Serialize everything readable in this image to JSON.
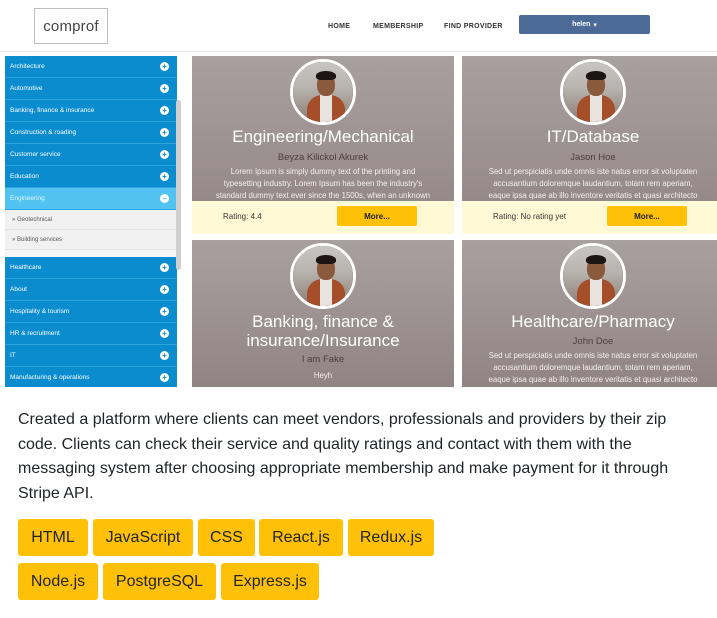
{
  "app": {
    "logo": "comprof",
    "nav": [
      "HOME",
      "MEMBERSHIP",
      "FIND PROVIDER"
    ],
    "user": "helen",
    "user_caret": "▾"
  },
  "sidebar": {
    "items": [
      "Architecture",
      "Automotive",
      "Banking, finance & insurance",
      "Construction & roading",
      "Customer service",
      "Education",
      "Engineering"
    ],
    "subitems": [
      "Geotechnical",
      "Building services"
    ],
    "items_after": [
      "Healthcare",
      "About",
      "Hospitality & tourism",
      "HR & recruitment",
      "IT",
      "Manufacturing & operations"
    ],
    "plus": "+",
    "minus": "−",
    "sub_bullet": "»"
  },
  "cards": [
    {
      "title_lines": [
        "Engineering/Mechanical"
      ],
      "name": "Beyza Kilickol Akurek",
      "desc_lines": [
        "Lorem Ipsum is simply dummy text of the printing and",
        "typesetting industry. Lorem Ipsum has been the industry's",
        "standard dummy text ever since the 1500s, when an unknown"
      ],
      "rating": "Rating: 4.4",
      "more": "More..."
    },
    {
      "title_lines": [
        "IT/Database"
      ],
      "name": "Jason Hoe",
      "desc_lines": [
        "Sed ut perspiciatis unde omnis iste natus error sit voluptaten",
        "accusantium doloremque laudantium, totam rem aperiam,",
        "eaque ipsa quae ab illo inventore veritatis et quasi architecto"
      ],
      "rating": "Rating: No rating yet",
      "more": "More..."
    },
    {
      "title_lines": [
        "Banking, finance &",
        "insurance/Insurance"
      ],
      "name": "I am Fake",
      "desc_lines": [
        "Heyh"
      ]
    },
    {
      "title_lines": [
        "Healthcare/Pharmacy"
      ],
      "name": "John Doe",
      "desc_lines": [
        "Sed ut perspiciatis unde omnis iste natus error sit voluptaten",
        "accusantium doloremque laudantium, totam rem aperiam,",
        "eaque ipsa quae ab illo inventore veritatis et quasi architecto"
      ]
    }
  ],
  "description": "Created a platform where clients can meet vendors, professionals and providers by their zip code. Clients can check their service and quality ratings and contact with them with the messaging system after choosing appropriate membership and make payment for it through Stripe API.",
  "tags": [
    "HTML",
    "JavaScript",
    "CSS",
    "React.js",
    "Redux.js",
    "Node.js",
    "PostgreSQL",
    "Express.js"
  ],
  "colors": {
    "sidebar": "#0a8ccf",
    "sidebar_active": "#52c3f0",
    "tag": "#ffc107",
    "user_button": "#4b6a95",
    "card_footer": "#fff9d6"
  }
}
